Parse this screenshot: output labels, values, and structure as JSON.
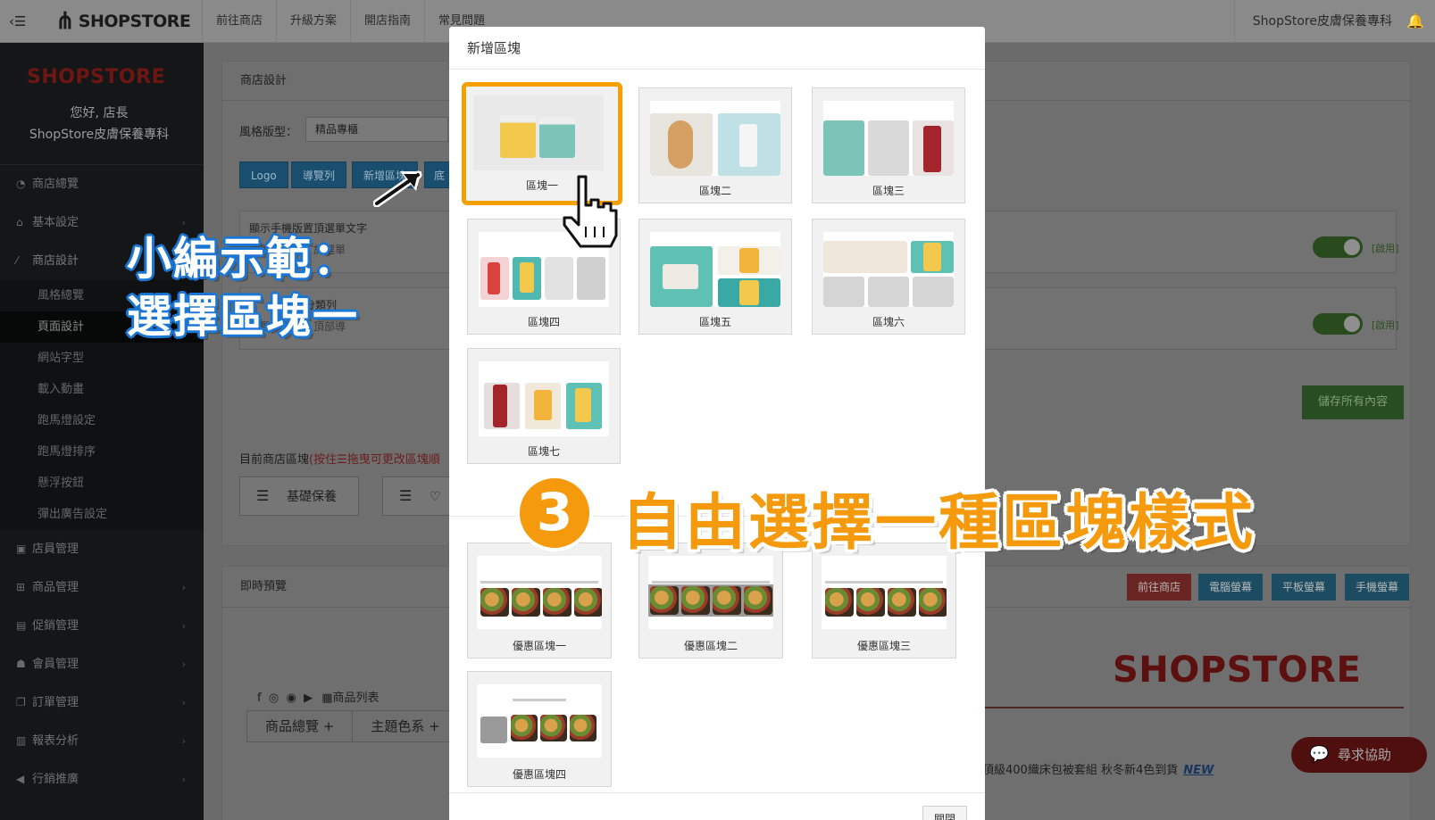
{
  "topbar": {
    "brand": "SHOPSTORE",
    "nav": [
      "前往商店",
      "升級方案",
      "開店指南",
      "常見問題"
    ],
    "shop_name": "ShopStore皮膚保養專科"
  },
  "sidebar": {
    "logo": "SHOPSTORE",
    "greeting": "您好, 店長",
    "shop_name": "ShopStore皮膚保養專科",
    "items": [
      {
        "label": "商店總覽",
        "icon": "dashboard-icon"
      },
      {
        "label": "基本設定",
        "icon": "bank-icon"
      },
      {
        "label": "商店設計",
        "icon": "wand-icon"
      }
    ],
    "sub_items": [
      "風格總覽",
      "頁面設計",
      "網站字型",
      "載入動畫",
      "跑馬燈設定",
      "跑馬燈排序",
      "懸浮按鈕",
      "彈出廣告設定"
    ],
    "items_after": [
      {
        "label": "店員管理",
        "icon": "lock-icon"
      },
      {
        "label": "商品管理",
        "icon": "cart-icon"
      },
      {
        "label": "促銷管理",
        "icon": "gift-icon"
      },
      {
        "label": "會員管理",
        "icon": "users-icon"
      },
      {
        "label": "訂單管理",
        "icon": "copy-icon"
      },
      {
        "label": "報表分析",
        "icon": "chart-icon"
      },
      {
        "label": "行銷推廣",
        "icon": "megaphone-icon"
      }
    ]
  },
  "design_panel": {
    "title": "商店設計",
    "style_label": "風格版型：",
    "style_value": "精品專櫃",
    "buttons": [
      "Logo",
      "導覽列",
      "新增區塊",
      "底"
    ],
    "option1_title": "顯示手機版置頂選單文字",
    "option1_desc": "裝置瀏覽時，於選單",
    "option2_title": "部分類列",
    "option2_desc": "裝置瀏覽時，頂部導",
    "toggle_label": "[啟用]",
    "save_button": "儲存所有內容",
    "current_blocks_label": "目前商店區塊",
    "current_blocks_hint": "(按住☰拖曳可更改區塊順",
    "block_chip_1": "基礎保養",
    "block_chip_2": "♡"
  },
  "preview_panel": {
    "title": "即時預覽",
    "buttons": [
      "前往商店",
      "電腦螢幕",
      "平板螢幕",
      "手機螢幕"
    ],
    "logo": "SHOPSTORE",
    "product_list": "商品列表",
    "tabs": [
      "商品總覽 +",
      "主題色系 +"
    ],
    "marquee": "頂級400織床包被套組 秋冬新4色到貨",
    "marquee_new": "NEW",
    "help_button": "尋求協助"
  },
  "modal": {
    "title": "新增區塊",
    "blocks": [
      "區塊一",
      "區塊二",
      "區塊三",
      "區塊四",
      "區塊五",
      "區塊六",
      "區塊七"
    ],
    "promo_blocks": [
      "優惠區塊一",
      "優惠區塊二",
      "優惠區塊三",
      "優惠區塊四"
    ],
    "close_button": "關閉",
    "selected_block": "區塊一"
  },
  "annotations": {
    "callout_line1": "小編示範：",
    "callout_line2": "選擇區塊一",
    "step_number": "3",
    "step_text": "自由選擇一種區塊樣式"
  },
  "colors": {
    "accent_orange": "#f59a0c",
    "callout_blue": "#1c76d4",
    "brand_red": "#b5211d"
  }
}
